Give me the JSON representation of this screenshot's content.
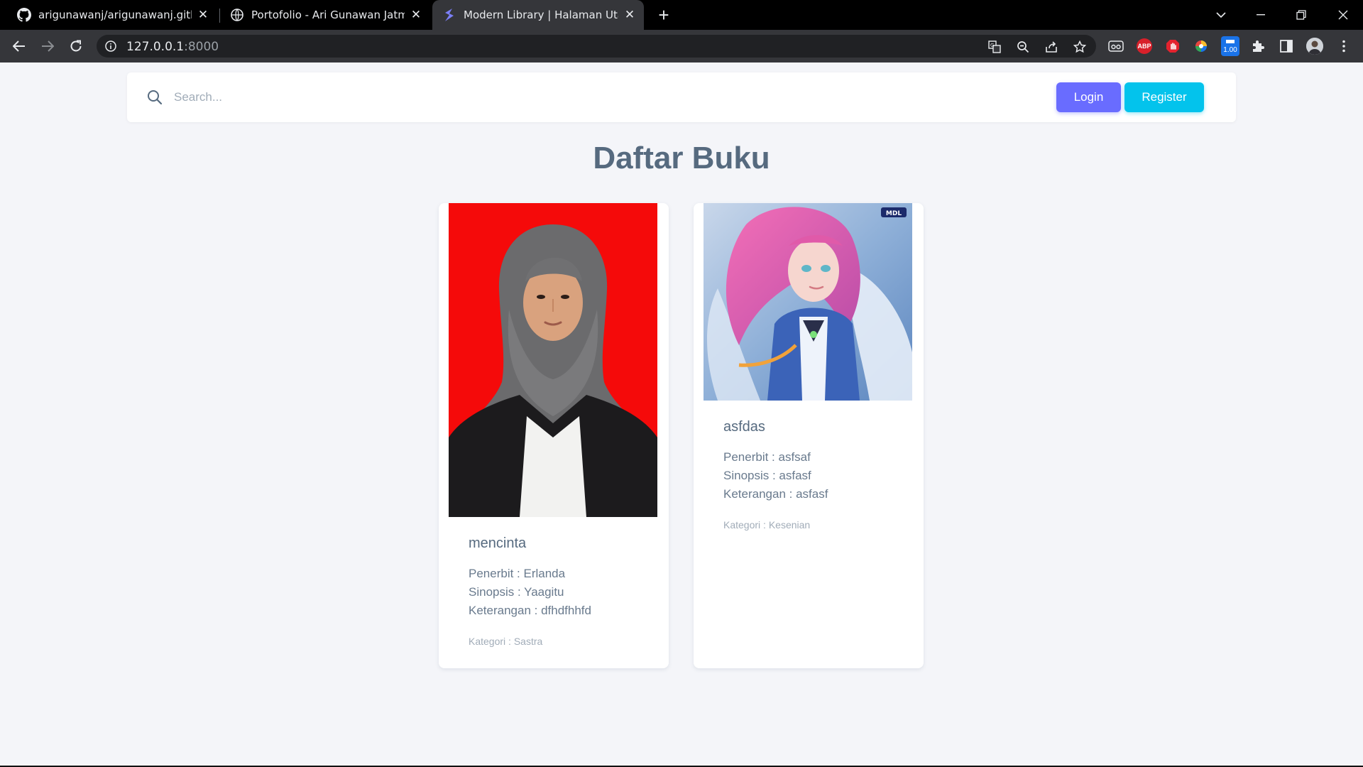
{
  "browser": {
    "tabs": [
      {
        "title": "arigunawanj/arigunawanj.github.",
        "icon": "github-icon"
      },
      {
        "title": "Portofolio - Ari Gunawan Jatmiko",
        "icon": "globe-icon"
      },
      {
        "title": "Modern Library | Halaman Utama",
        "icon": "app-logo-icon"
      }
    ],
    "url_host": "127.0.0.1",
    "url_port": ":8000",
    "extension_badge": "1.00",
    "abp_label": "ABP"
  },
  "navbar": {
    "search_placeholder": "Search...",
    "login_label": "Login",
    "register_label": "Register"
  },
  "page": {
    "title": "Daftar Buku"
  },
  "books": [
    {
      "title": "mencinta",
      "penerbit": "Penerbit : Erlanda",
      "sinopsis": "Sinopsis : Yaagitu",
      "keterangan": "Keterangan : dfhdfhhfd",
      "kategori": "Kategori : Sastra"
    },
    {
      "title": "asfdas",
      "penerbit": "Penerbit : asfsaf",
      "sinopsis": "Sinopsis : asfasf",
      "keterangan": "Keterangan : asfasf",
      "kategori": "Kategori : Kesenian",
      "badge": "MDL"
    }
  ],
  "colors": {
    "primary": "#696cff",
    "info": "#03c3ec",
    "page_bg": "#f4f5f9",
    "heading": "#566a7f"
  }
}
